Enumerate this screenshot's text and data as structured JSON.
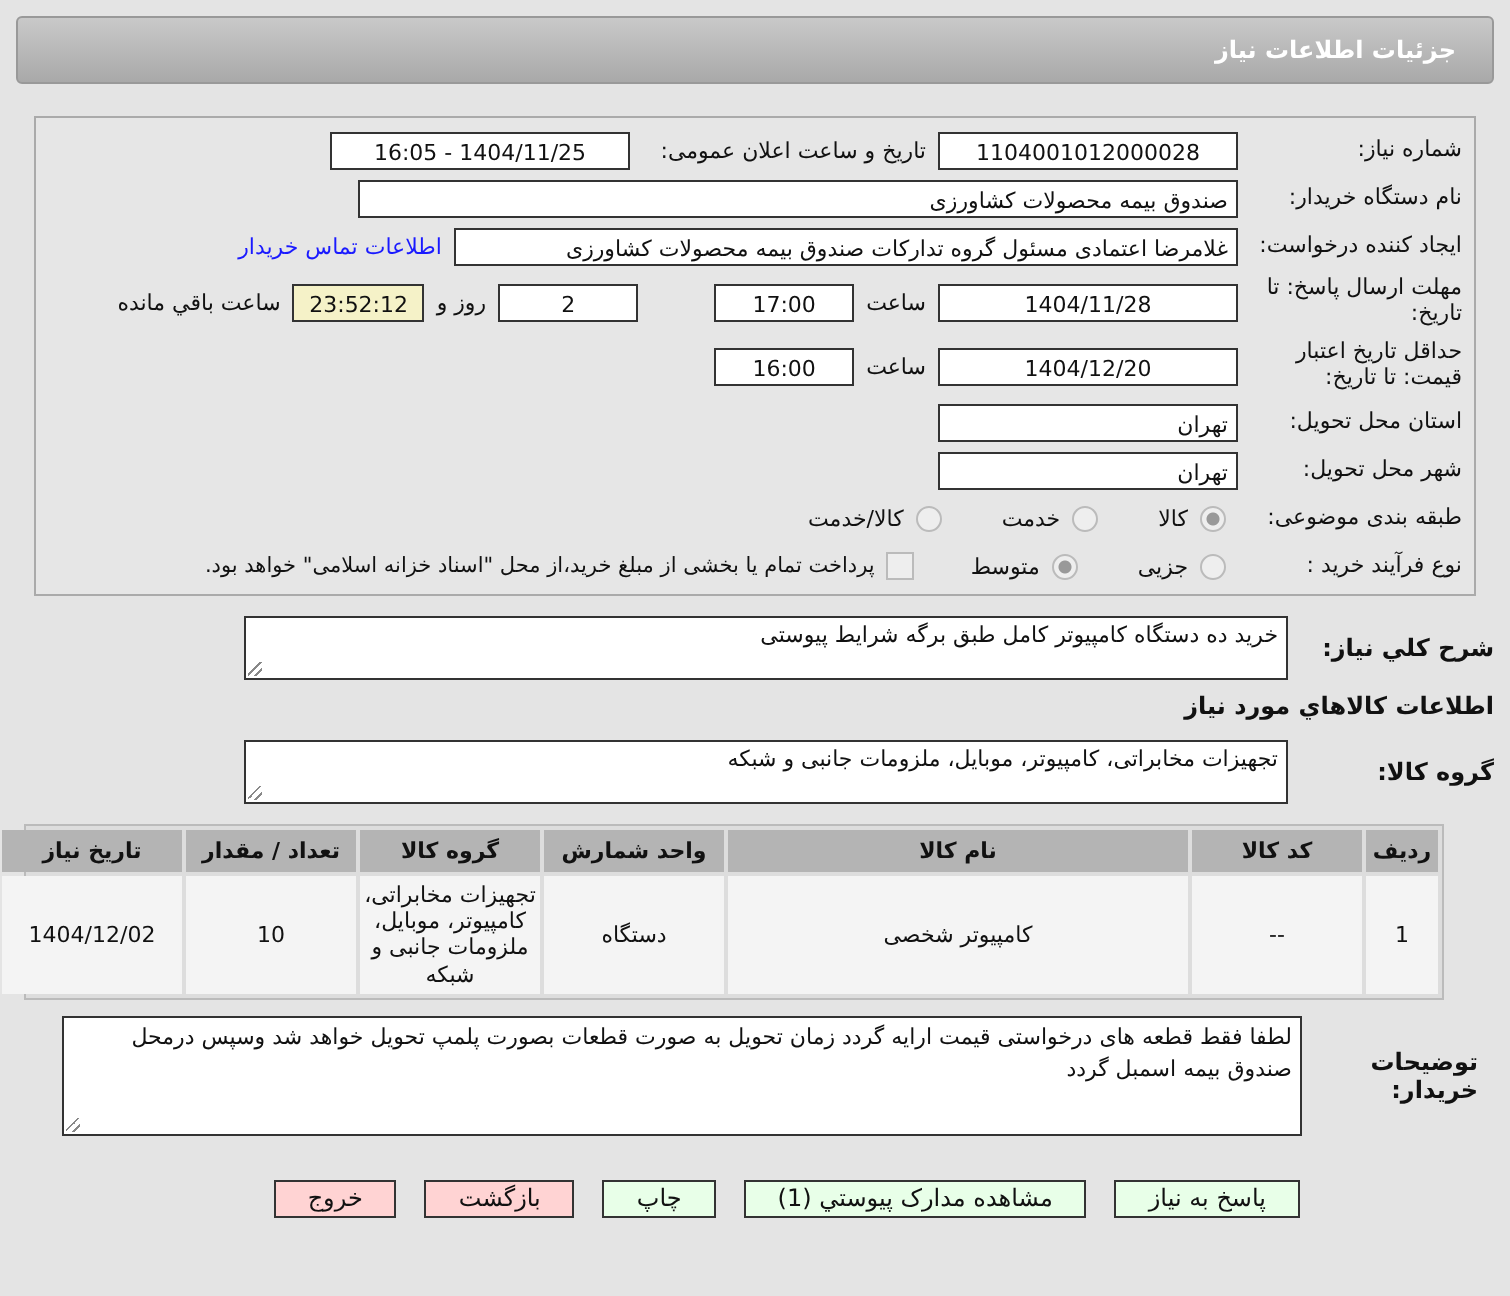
{
  "header": {
    "title": "جزئیات اطلاعات نیاز"
  },
  "need_number": {
    "label": "شماره نیاز:",
    "value": "1104001012000028"
  },
  "announce": {
    "label": "تاریخ و ساعت اعلان عمومی:",
    "value": "1404/11/25 - 16:05"
  },
  "buyer": {
    "label": "نام دستگاه خریدار:",
    "value": "صندوق بیمه محصولات کشاورزی"
  },
  "creator": {
    "label": "ایجاد کننده درخواست:",
    "value": "غلامرضا اعتمادی مسئول گروه تدارکات صندوق بیمه محصولات کشاورزی",
    "link": "اطلاعات تماس خریدار"
  },
  "deadline": {
    "label": "مهلت ارسال پاسخ: تا تاریخ:",
    "date": "1404/11/28",
    "time_label": "ساعت",
    "time": "17:00",
    "days": "2",
    "days_label": "روز و",
    "remaining": "23:52:12",
    "remaining_label": "ساعت باقي مانده"
  },
  "validity": {
    "label": "حداقل تاریخ اعتبار قیمت: تا تاریخ:",
    "date": "1404/12/20",
    "time_label": "ساعت",
    "time": "16:00"
  },
  "province": {
    "label": "استان محل تحویل:",
    "value": "تهران"
  },
  "city": {
    "label": "شهر محل تحویل:",
    "value": "تهران"
  },
  "category": {
    "label": "طبقه بندی موضوعی:",
    "options": [
      {
        "label": "کالا",
        "selected": true
      },
      {
        "label": "خدمت",
        "selected": false
      },
      {
        "label": "کالا/خدمت",
        "selected": false
      }
    ]
  },
  "process": {
    "label": "نوع فرآیند خرید :",
    "options": [
      {
        "label": "جزیی",
        "selected": false
      },
      {
        "label": "متوسط",
        "selected": true
      }
    ],
    "treasury": {
      "checked": false,
      "label": "پرداخت تمام یا بخشی از مبلغ خرید،از محل \"اسناد خزانه اسلامی\" خواهد بود."
    }
  },
  "description": {
    "label": "شرح کلي نیاز:",
    "value": "خرید ده دستگاه کامپیوتر کامل طبق برگه شرایط پیوستی"
  },
  "goods_heading": "اطلاعات کالاهاي مورد نياز",
  "goods_group": {
    "label": "گروه کالا:",
    "value": "تجهیزات مخابراتی، کامپیوتر، موبایل، ملزومات جانبی و شبکه"
  },
  "table": {
    "columns": [
      "ردیف",
      "کد کالا",
      "نام کالا",
      "واحد شمارش",
      "گروه کالا",
      "تعداد / مقدار",
      "تاریخ نیاز"
    ],
    "rows": [
      [
        "1",
        "--",
        "کامپیوتر شخصی",
        "دستگاه",
        "تجهیزات مخابراتی، کامپیوتر، موبایل، ملزومات جانبی و شبکه",
        "10",
        "1404/12/02"
      ]
    ]
  },
  "notes": {
    "label": "توضیحات خریدار:",
    "value": "لطفا فقط قطعه های درخواستی قیمت ارایه گردد زمان تحویل به صورت قطعات بصورت پلمپ تحویل خواهد شد وسپس درمحل صندوق بیمه اسمبل گردد"
  },
  "buttons": [
    {
      "label": "پاسخ به نیاز",
      "kind": "action"
    },
    {
      "label": "مشاهده مدارک پیوستي (1)",
      "kind": "action"
    },
    {
      "label": "چاپ",
      "kind": "action"
    },
    {
      "label": "بازگشت",
      "kind": "exit"
    },
    {
      "label": "خروج",
      "kind": "exit"
    }
  ]
}
